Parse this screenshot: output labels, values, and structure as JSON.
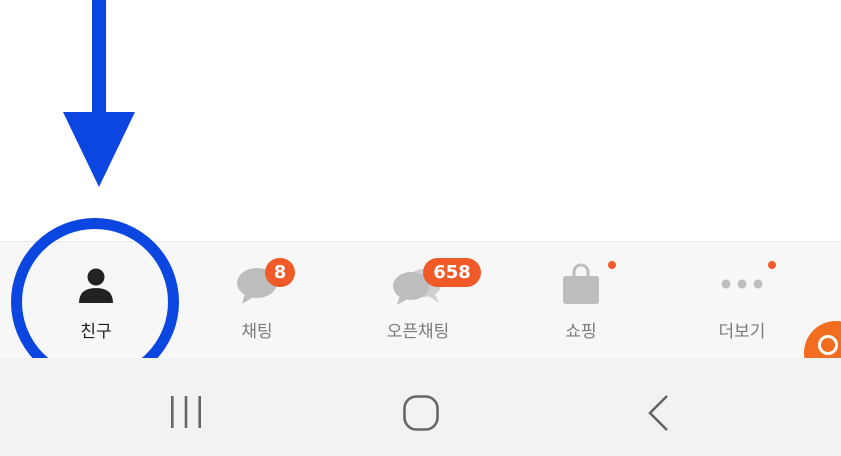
{
  "colors": {
    "annotation": "#0b46e0",
    "badge": "#f05a28",
    "icon_active": "#222222",
    "icon_inactive": "#bdbdbd",
    "fab": "#f36d20"
  },
  "tabs": [
    {
      "id": "friends",
      "label": "친구",
      "icon": "person-icon",
      "active": true
    },
    {
      "id": "chats",
      "label": "채팅",
      "icon": "chat-bubble-icon",
      "badge": "8"
    },
    {
      "id": "openchat",
      "label": "오픈채팅",
      "icon": "open-chat-icon",
      "badge": "658"
    },
    {
      "id": "shopping",
      "label": "쇼핑",
      "icon": "shopping-bag-icon",
      "new_dot": true
    },
    {
      "id": "more",
      "label": "더보기",
      "icon": "more-dots-icon",
      "new_dot": true
    }
  ],
  "system_nav": [
    {
      "id": "recents",
      "icon": "recent-apps-icon"
    },
    {
      "id": "home",
      "icon": "home-icon"
    },
    {
      "id": "back",
      "icon": "back-icon"
    }
  ],
  "annotations": {
    "arrow": "down-arrow",
    "highlight_ring": "circle-around-friends-tab"
  }
}
